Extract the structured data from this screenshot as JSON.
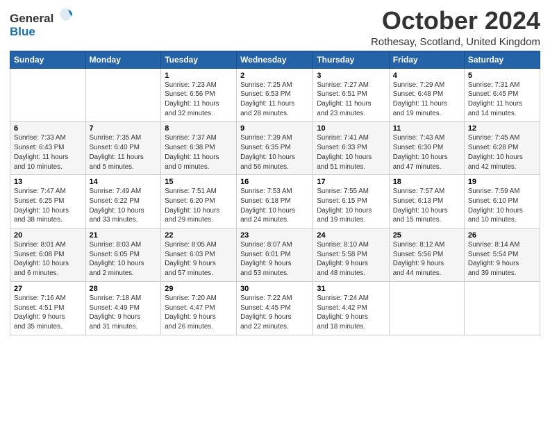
{
  "logo": {
    "general": "General",
    "blue": "Blue"
  },
  "title": "October 2024",
  "subtitle": "Rothesay, Scotland, United Kingdom",
  "days_header": [
    "Sunday",
    "Monday",
    "Tuesday",
    "Wednesday",
    "Thursday",
    "Friday",
    "Saturday"
  ],
  "weeks": [
    [
      {
        "day": "",
        "detail": ""
      },
      {
        "day": "",
        "detail": ""
      },
      {
        "day": "1",
        "detail": "Sunrise: 7:23 AM\nSunset: 6:56 PM\nDaylight: 11 hours\nand 32 minutes."
      },
      {
        "day": "2",
        "detail": "Sunrise: 7:25 AM\nSunset: 6:53 PM\nDaylight: 11 hours\nand 28 minutes."
      },
      {
        "day": "3",
        "detail": "Sunrise: 7:27 AM\nSunset: 6:51 PM\nDaylight: 11 hours\nand 23 minutes."
      },
      {
        "day": "4",
        "detail": "Sunrise: 7:29 AM\nSunset: 6:48 PM\nDaylight: 11 hours\nand 19 minutes."
      },
      {
        "day": "5",
        "detail": "Sunrise: 7:31 AM\nSunset: 6:45 PM\nDaylight: 11 hours\nand 14 minutes."
      }
    ],
    [
      {
        "day": "6",
        "detail": "Sunrise: 7:33 AM\nSunset: 6:43 PM\nDaylight: 11 hours\nand 10 minutes."
      },
      {
        "day": "7",
        "detail": "Sunrise: 7:35 AM\nSunset: 6:40 PM\nDaylight: 11 hours\nand 5 minutes."
      },
      {
        "day": "8",
        "detail": "Sunrise: 7:37 AM\nSunset: 6:38 PM\nDaylight: 11 hours\nand 0 minutes."
      },
      {
        "day": "9",
        "detail": "Sunrise: 7:39 AM\nSunset: 6:35 PM\nDaylight: 10 hours\nand 56 minutes."
      },
      {
        "day": "10",
        "detail": "Sunrise: 7:41 AM\nSunset: 6:33 PM\nDaylight: 10 hours\nand 51 minutes."
      },
      {
        "day": "11",
        "detail": "Sunrise: 7:43 AM\nSunset: 6:30 PM\nDaylight: 10 hours\nand 47 minutes."
      },
      {
        "day": "12",
        "detail": "Sunrise: 7:45 AM\nSunset: 6:28 PM\nDaylight: 10 hours\nand 42 minutes."
      }
    ],
    [
      {
        "day": "13",
        "detail": "Sunrise: 7:47 AM\nSunset: 6:25 PM\nDaylight: 10 hours\nand 38 minutes."
      },
      {
        "day": "14",
        "detail": "Sunrise: 7:49 AM\nSunset: 6:22 PM\nDaylight: 10 hours\nand 33 minutes."
      },
      {
        "day": "15",
        "detail": "Sunrise: 7:51 AM\nSunset: 6:20 PM\nDaylight: 10 hours\nand 29 minutes."
      },
      {
        "day": "16",
        "detail": "Sunrise: 7:53 AM\nSunset: 6:18 PM\nDaylight: 10 hours\nand 24 minutes."
      },
      {
        "day": "17",
        "detail": "Sunrise: 7:55 AM\nSunset: 6:15 PM\nDaylight: 10 hours\nand 19 minutes."
      },
      {
        "day": "18",
        "detail": "Sunrise: 7:57 AM\nSunset: 6:13 PM\nDaylight: 10 hours\nand 15 minutes."
      },
      {
        "day": "19",
        "detail": "Sunrise: 7:59 AM\nSunset: 6:10 PM\nDaylight: 10 hours\nand 10 minutes."
      }
    ],
    [
      {
        "day": "20",
        "detail": "Sunrise: 8:01 AM\nSunset: 6:08 PM\nDaylight: 10 hours\nand 6 minutes."
      },
      {
        "day": "21",
        "detail": "Sunrise: 8:03 AM\nSunset: 6:05 PM\nDaylight: 10 hours\nand 2 minutes."
      },
      {
        "day": "22",
        "detail": "Sunrise: 8:05 AM\nSunset: 6:03 PM\nDaylight: 9 hours\nand 57 minutes."
      },
      {
        "day": "23",
        "detail": "Sunrise: 8:07 AM\nSunset: 6:01 PM\nDaylight: 9 hours\nand 53 minutes."
      },
      {
        "day": "24",
        "detail": "Sunrise: 8:10 AM\nSunset: 5:58 PM\nDaylight: 9 hours\nand 48 minutes."
      },
      {
        "day": "25",
        "detail": "Sunrise: 8:12 AM\nSunset: 5:56 PM\nDaylight: 9 hours\nand 44 minutes."
      },
      {
        "day": "26",
        "detail": "Sunrise: 8:14 AM\nSunset: 5:54 PM\nDaylight: 9 hours\nand 39 minutes."
      }
    ],
    [
      {
        "day": "27",
        "detail": "Sunrise: 7:16 AM\nSunset: 4:51 PM\nDaylight: 9 hours\nand 35 minutes."
      },
      {
        "day": "28",
        "detail": "Sunrise: 7:18 AM\nSunset: 4:49 PM\nDaylight: 9 hours\nand 31 minutes."
      },
      {
        "day": "29",
        "detail": "Sunrise: 7:20 AM\nSunset: 4:47 PM\nDaylight: 9 hours\nand 26 minutes."
      },
      {
        "day": "30",
        "detail": "Sunrise: 7:22 AM\nSunset: 4:45 PM\nDaylight: 9 hours\nand 22 minutes."
      },
      {
        "day": "31",
        "detail": "Sunrise: 7:24 AM\nSunset: 4:42 PM\nDaylight: 9 hours\nand 18 minutes."
      },
      {
        "day": "",
        "detail": ""
      },
      {
        "day": "",
        "detail": ""
      }
    ]
  ]
}
